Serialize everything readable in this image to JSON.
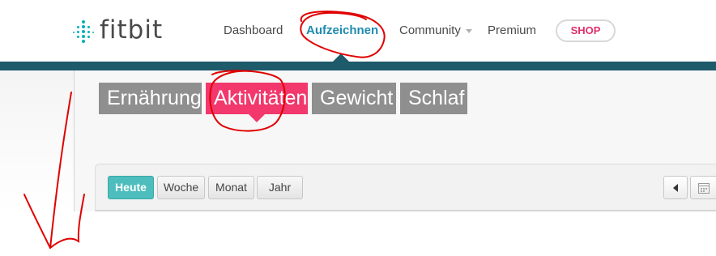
{
  "header": {
    "logo_text": "fitbit",
    "nav": [
      {
        "label": "Dashboard",
        "active": false
      },
      {
        "label": "Aufzeichnen",
        "active": true
      },
      {
        "label": "Community",
        "active": false,
        "has_dropdown": true
      },
      {
        "label": "Premium",
        "active": false
      }
    ],
    "shop_label": "SHOP"
  },
  "categories": [
    {
      "label": "Ernährung",
      "active": false
    },
    {
      "label": "Aktivitäten",
      "active": true
    },
    {
      "label": "Gewicht",
      "active": false
    },
    {
      "label": "Schlaf",
      "active": false
    }
  ],
  "periods": [
    {
      "label": "Heute",
      "active": true
    },
    {
      "label": "Woche",
      "active": false
    },
    {
      "label": "Monat",
      "active": false
    },
    {
      "label": "Jahr",
      "active": false
    }
  ],
  "icons": {
    "prev": "chevron-left-icon",
    "calendar": "calendar-icon"
  },
  "colors": {
    "brand_teal": "#00b0b9",
    "nav_active": "#1e8bb0",
    "shop_pink": "#e0306a",
    "topbar": "#1d5a6a",
    "category_active": "#f2386c",
    "category_inactive": "#8f8f8f",
    "period_active": "#4dbdbd",
    "annotation_red": "#e00000"
  }
}
